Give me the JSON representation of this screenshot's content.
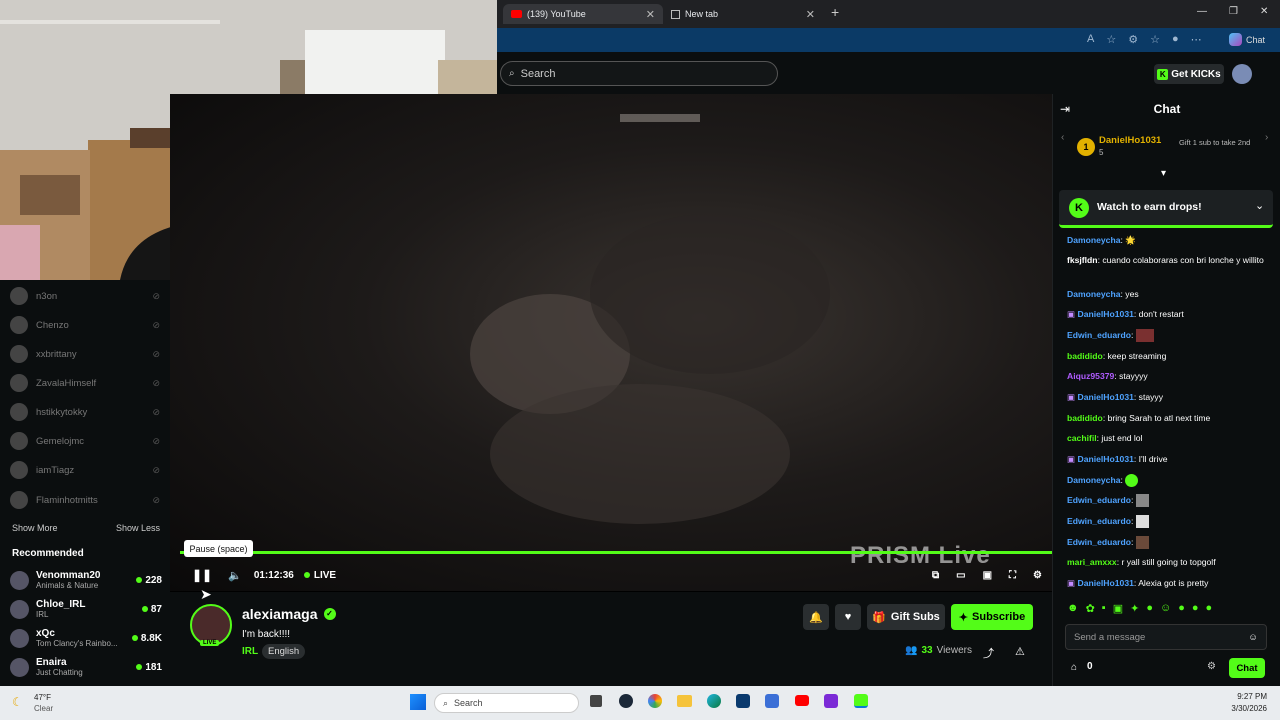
{
  "browser": {
    "tabs": [
      {
        "label": "(139) YouTube"
      },
      {
        "label": "New tab"
      }
    ],
    "new_tab_glyph": "+"
  },
  "header": {
    "search_placeholder": "Search",
    "get_kicks_label": "Get KICKs"
  },
  "sidebar": {
    "following": [
      {
        "name": "n3on"
      },
      {
        "name": "Chenzo"
      },
      {
        "name": "xxbrittany"
      },
      {
        "name": "ZavalaHimself"
      },
      {
        "name": "hstikkytokky"
      },
      {
        "name": "Gemelojmc"
      },
      {
        "name": "iamTiagz"
      },
      {
        "name": "Flaminhotmitts"
      }
    ],
    "show_more": "Show More",
    "show_less": "Show Less",
    "recommended_title": "Recommended",
    "recommended": [
      {
        "name": "Venomman20",
        "category": "Animals & Nature",
        "viewers": "228"
      },
      {
        "name": "Chloe_IRL",
        "category": "IRL",
        "viewers": "87"
      },
      {
        "name": "xQc",
        "category": "Tom Clancy's Rainbo...",
        "viewers": "8.8K"
      },
      {
        "name": "Enaira",
        "category": "Just Chatting",
        "viewers": "181"
      }
    ]
  },
  "player": {
    "tooltip": "Pause (space)",
    "elapsed": "01:12:36",
    "live_label": "LIVE",
    "watermark": "PRISM Live",
    "progress_pct": 100
  },
  "channel": {
    "name": "alexiamaga",
    "title": "I'm back!!!!",
    "category": "IRL",
    "language": "English",
    "avatar_live": "LIVE",
    "viewers": "33",
    "viewers_label": "Viewers",
    "gift_label": "Gift Subs",
    "subscribe_label": "Subscribe"
  },
  "chat": {
    "title": "Chat",
    "pinned_user": "DanielHo1031",
    "pinned_rank": "1",
    "pinned_count": "5",
    "pinned_note": "Gift 1 sub to take 2nd",
    "drops_label": "Watch to earn drops!",
    "messages": [
      {
        "user": "Damoneycha",
        "text": "",
        "color": "#4fa3ff"
      },
      {
        "user": "fksjfldn",
        "text": "cuando colaboraras con bri lonche y willito",
        "color": "#ffffff"
      },
      {
        "user": "Damoneycha",
        "text": "yes",
        "color": "#4fa3ff"
      },
      {
        "user": "DanielHo1031",
        "text": "don't restart",
        "color": "#4fa3ff"
      },
      {
        "user": "Edwin_eduardo",
        "text": "",
        "color": "#4fa3ff"
      },
      {
        "user": "badidido",
        "text": "keep streaming",
        "color": "#53fc18"
      },
      {
        "user": "Aiquz95379",
        "text": "stayyyy",
        "color": "#b05cff"
      },
      {
        "user": "DanielHo1031",
        "text": "stayyy",
        "color": "#4fa3ff"
      },
      {
        "user": "badidido",
        "text": "bring Sarah to atl next time",
        "color": "#53fc18"
      },
      {
        "user": "cachifil",
        "text": "just end lol",
        "color": "#53fc18"
      },
      {
        "user": "DanielHo1031",
        "text": "I'll drive",
        "color": "#4fa3ff"
      },
      {
        "user": "Damoneycha",
        "text": "",
        "color": "#4fa3ff"
      },
      {
        "user": "Edwin_eduardo",
        "text": "",
        "color": "#4fa3ff"
      },
      {
        "user": "Edwin_eduardo",
        "text": "",
        "color": "#4fa3ff"
      },
      {
        "user": "Edwin_eduardo",
        "text": "",
        "color": "#4fa3ff"
      },
      {
        "user": "mari_amxxx",
        "text": "r yall still going to topgolf",
        "color": "#53fc18"
      },
      {
        "user": "DanielHo1031",
        "text": "Alexia got is pretty",
        "color": "#4fa3ff"
      }
    ],
    "input_placeholder": "Send a message",
    "points": "0",
    "send_label": "Chat"
  },
  "taskbar": {
    "weather_temp": "47°F",
    "weather_desc": "Clear",
    "search_label": "Search",
    "time": "9:27 PM",
    "date": "3/30/2026"
  },
  "colors": {
    "accent": "#53fc18",
    "bg": "#0b0e0f"
  }
}
